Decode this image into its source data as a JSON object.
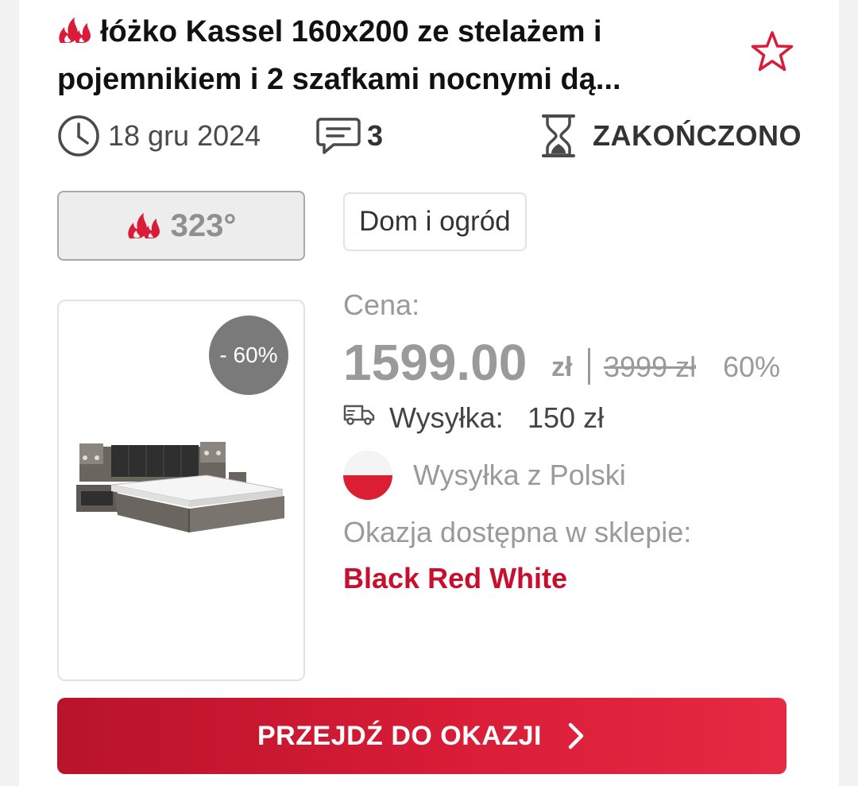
{
  "deal": {
    "title": "łóżko Kassel 160x200 ze stelażem i pojemnikiem i 2 szafkami nocnymi dą...",
    "date": "18 gru 2024",
    "comments_count": "3",
    "status": "ZAKOŃCZONO",
    "temperature": "323°",
    "category": "Dom i ogród",
    "discount_badge": "- 60%",
    "price_label": "Cena:",
    "price": "1599.00",
    "currency": "zł",
    "old_price": "3999 zł",
    "discount_percent": "60%",
    "shipping_label": "Wysyłka:",
    "shipping_cost": "150 zł",
    "ships_from": "Wysyłka z Polski",
    "available_in_label": "Okazja dostępna w sklepie:",
    "shop_name": "Black Red White",
    "cta_label": "PRZEJDŹ DO OKAZJI"
  },
  "icons": {
    "title": "fire-icon",
    "favorite": "star-icon",
    "date": "clock-icon",
    "comments": "comment-icon",
    "status": "hourglass-icon",
    "temperature": "fire-icon",
    "shipping": "truck-icon",
    "origin": "poland-flag-icon",
    "cta": "chevron-right-icon"
  },
  "colors": {
    "accent": "#c8102e",
    "cta_start": "#b8142a",
    "cta_end": "#e52a44",
    "muted": "#9a9a9a",
    "badge": "#7a7a7a"
  }
}
